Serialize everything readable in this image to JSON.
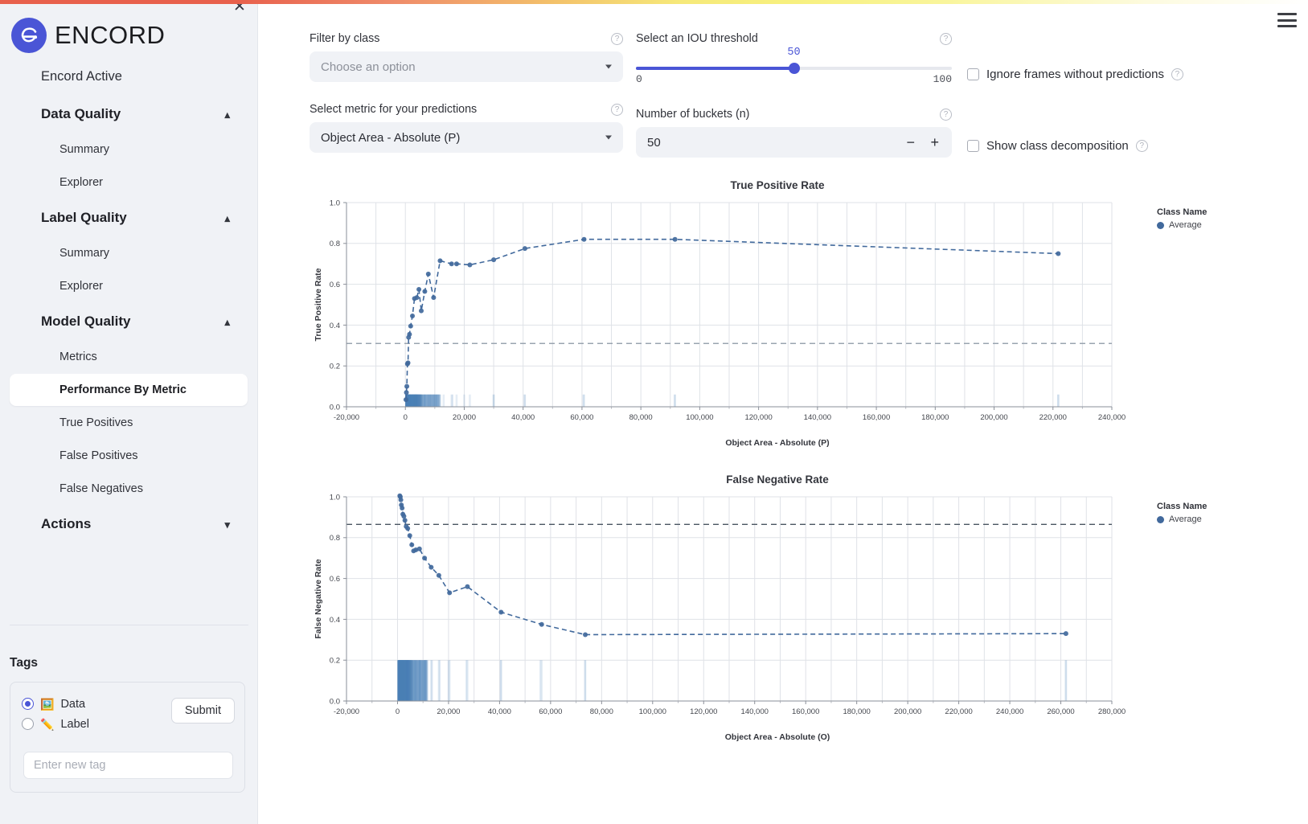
{
  "app": {
    "brand_name": "ENCORD",
    "close_icon": "close-icon",
    "menu_icon": "hamburger-icon"
  },
  "sidebar": {
    "top_item": "Encord Active",
    "sections": [
      {
        "label": "Data Quality",
        "expanded": true,
        "chevron": "chevron-up-icon",
        "items": [
          {
            "label": "Summary",
            "active": false
          },
          {
            "label": "Explorer",
            "active": false
          }
        ]
      },
      {
        "label": "Label Quality",
        "expanded": true,
        "chevron": "chevron-up-icon",
        "items": [
          {
            "label": "Summary",
            "active": false
          },
          {
            "label": "Explorer",
            "active": false
          }
        ]
      },
      {
        "label": "Model Quality",
        "expanded": true,
        "chevron": "chevron-up-icon",
        "items": [
          {
            "label": "Metrics",
            "active": false
          },
          {
            "label": "Performance By Metric",
            "active": true
          },
          {
            "label": "True Positives",
            "active": false
          },
          {
            "label": "False Positives",
            "active": false
          },
          {
            "label": "False Negatives",
            "active": false
          }
        ]
      },
      {
        "label": "Actions",
        "expanded": false,
        "chevron": "chevron-down-icon",
        "items": []
      }
    ],
    "tags": {
      "title": "Tags",
      "options": [
        {
          "label": "Data",
          "emoji": "🖼️",
          "selected": true
        },
        {
          "label": "Label",
          "emoji": "✏️",
          "selected": false
        }
      ],
      "submit_label": "Submit",
      "input_value": "",
      "input_placeholder": "Enter new tag"
    }
  },
  "controls": {
    "filter_by_class": {
      "label": "Filter by class",
      "value": "Choose an option",
      "is_placeholder": true,
      "help_icon": "help-circle-icon"
    },
    "metric_select": {
      "label": "Select metric for your predictions",
      "value": "Object Area - Absolute (P)",
      "is_placeholder": false,
      "help_icon": "help-circle-icon"
    },
    "iou_threshold": {
      "label": "Select an IOU threshold",
      "value": "50",
      "min": "0",
      "max": "100",
      "help_icon": "help-circle-icon"
    },
    "buckets": {
      "label": "Number of buckets (n)",
      "value": "50",
      "minus": "−",
      "plus": "+",
      "help_icon": "help-circle-icon"
    },
    "ignore_frames": {
      "label": "Ignore frames without predictions",
      "checked": false,
      "help_icon": "help-circle-icon"
    },
    "class_decomposition": {
      "label": "Show class decomposition",
      "checked": false,
      "help_icon": "help-circle-icon"
    }
  },
  "chart_data": [
    {
      "type": "line",
      "title": "True Positive Rate",
      "xlabel": "Object Area - Absolute (P)",
      "ylabel": "True Positive Rate",
      "xlim": [
        -20000,
        240000
      ],
      "ylim": [
        0.0,
        1.0
      ],
      "xticks": [
        "-20,000",
        "0",
        "20,000",
        "40,000",
        "60,000",
        "80,000",
        "100,000",
        "120,000",
        "140,000",
        "160,000",
        "180,000",
        "200,000",
        "220,000",
        "240,000"
      ],
      "xtick_values": [
        -20000,
        0,
        20000,
        40000,
        60000,
        80000,
        100000,
        120000,
        140000,
        160000,
        180000,
        200000,
        220000,
        240000
      ],
      "yticks": [
        "0.0",
        "0.2",
        "0.4",
        "0.6",
        "0.8",
        "1.0"
      ],
      "ytick_values": [
        0.0,
        0.2,
        0.4,
        0.6,
        0.8,
        1.0
      ],
      "grid": true,
      "legend_title": "Class Name",
      "legend_position": "right",
      "series": [
        {
          "name": "Average",
          "color": "#41699c",
          "style": "dashed-markers",
          "x": [
            200,
            350,
            500,
            700,
            900,
            1100,
            1400,
            1800,
            2400,
            3100,
            3900,
            4600,
            5400,
            6600,
            7800,
            9600,
            11800,
            15700,
            17400,
            21900,
            30000,
            40600,
            60700,
            91600,
            221800
          ],
          "y": [
            0.035,
            0.07,
            0.1,
            0.21,
            0.215,
            0.34,
            0.355,
            0.395,
            0.445,
            0.53,
            0.535,
            0.575,
            0.47,
            0.565,
            0.65,
            0.535,
            0.715,
            0.7,
            0.7,
            0.695,
            0.72,
            0.775,
            0.82,
            0.82,
            0.75
          ]
        }
      ],
      "reference_line": {
        "value": 0.31,
        "style": "dashed",
        "color": "#9aa4b0"
      },
      "histogram": {
        "description": "Vertical light-blue density bars along the x axis, densest near 0",
        "color": "#b9cfe2"
      }
    },
    {
      "type": "line",
      "title": "False Negative Rate",
      "xlabel": "Object Area - Absolute (O)",
      "ylabel": "False Negative Rate",
      "xlim": [
        -20000,
        280000
      ],
      "ylim": [
        0.0,
        1.0
      ],
      "xticks": [
        "-20,000",
        "0",
        "20,000",
        "40,000",
        "60,000",
        "80,000",
        "100,000",
        "120,000",
        "140,000",
        "160,000",
        "180,000",
        "200,000",
        "220,000",
        "240,000",
        "260,000",
        "280,000"
      ],
      "xtick_values": [
        -20000,
        0,
        20000,
        40000,
        60000,
        80000,
        100000,
        120000,
        140000,
        160000,
        180000,
        200000,
        220000,
        240000,
        260000,
        280000
      ],
      "yticks": [
        "0.0",
        "0.2",
        "0.4",
        "0.6",
        "0.8",
        "1.0"
      ],
      "ytick_values": [
        0.0,
        0.2,
        0.4,
        0.6,
        0.8,
        1.0
      ],
      "grid": true,
      "legend_title": "Class Name",
      "legend_position": "right",
      "series": [
        {
          "name": "Average",
          "color": "#41699c",
          "style": "dashed-markers",
          "x": [
            900,
            1100,
            1300,
            1500,
            1800,
            2100,
            2500,
            2900,
            3400,
            4000,
            4800,
            5600,
            6300,
            7200,
            8600,
            10600,
            13200,
            16200,
            20400,
            27400,
            40600,
            56500,
            73600,
            262000
          ],
          "y": [
            1.005,
            1.0,
            0.985,
            0.96,
            0.945,
            0.915,
            0.905,
            0.885,
            0.855,
            0.845,
            0.81,
            0.765,
            0.735,
            0.74,
            0.745,
            0.7,
            0.655,
            0.615,
            0.53,
            0.56,
            0.435,
            0.375,
            0.325,
            0.33
          ]
        }
      ],
      "reference_line": {
        "value": 0.865,
        "style": "dashed",
        "color": "#4a5561"
      },
      "histogram": {
        "description": "Vertical light-blue density bars along the x axis, densest near 0",
        "color": "#b9cfe2"
      }
    }
  ]
}
